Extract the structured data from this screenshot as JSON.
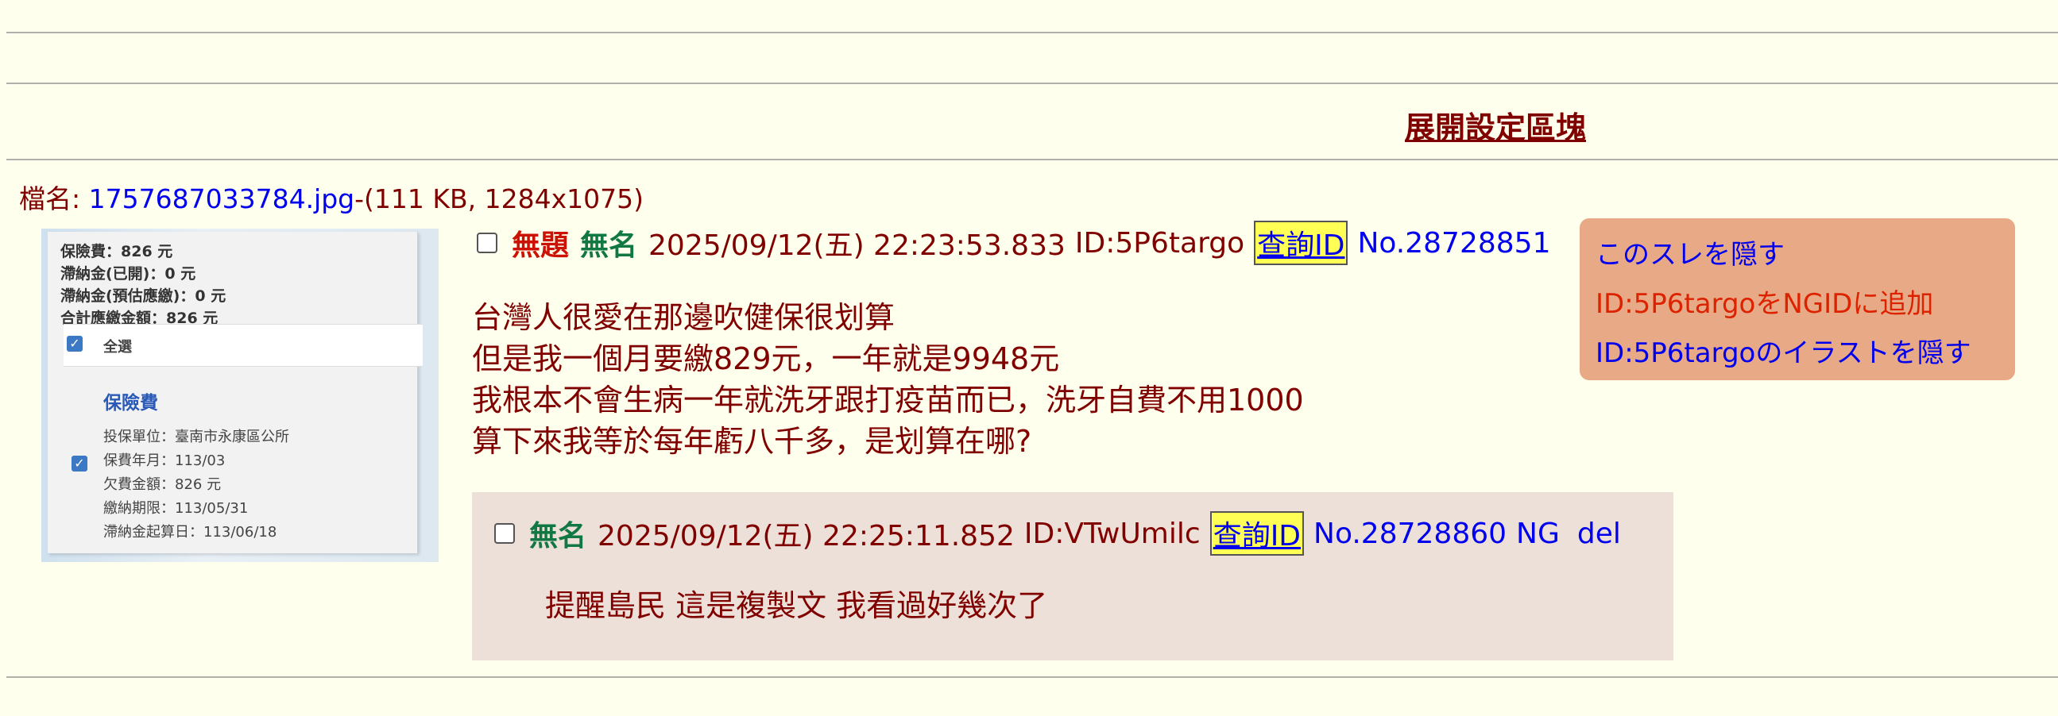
{
  "settings_toggle": "展開設定區塊",
  "file": {
    "label": "檔名:",
    "name": "1757687033784.jpg",
    "info": "-(111 KB, 1284x1075)"
  },
  "thumbnail": {
    "lines": [
      "保險費：826 元",
      "滯納金(已開)：0 元",
      "滯納金(預估應繳)：0 元",
      "合計應繳金額：826 元"
    ],
    "select_all": "全選",
    "section_title": "保險費",
    "details": [
      "投保單位：臺南市永康區公所",
      "保費年月：113/03",
      "欠費金額：826 元",
      "繳納期限：113/05/31",
      "滯納金起算日：113/06/18"
    ]
  },
  "post": {
    "subject": "無題",
    "name": "無名",
    "datetime": "2025/09/12(五) 22:23:53.833",
    "id": "ID:5P6targo",
    "query_id": "查詢ID",
    "number": "No.28728851",
    "body": [
      "台灣人很愛在那邊吹健保很划算",
      "但是我一個月要繳829元，一年就是9948元",
      "我根本不會生病一年就洗牙跟打疫苗而已，洗牙自費不用1000",
      "算下來我等於每年虧八千多，是划算在哪?"
    ]
  },
  "menu": {
    "hide_thread": "このスレを隠す",
    "add_ngid": "ID:5P6targoをNGIDに追加",
    "hide_illust": "ID:5P6targoのイラストを隠す",
    "colors": {
      "hide_thread": "#0000ee",
      "add_ngid": "#dd2200",
      "hide_illust": "#0000ee"
    }
  },
  "reply": {
    "name": "無名",
    "datetime": "2025/09/12(五) 22:25:11.852",
    "id": "ID:VTwUmilc",
    "query_id": "查詢ID",
    "number": "No.28728860",
    "ng": "NG",
    "del": "del",
    "body": "提醒島民 這是複製文 我看過好幾次了"
  }
}
